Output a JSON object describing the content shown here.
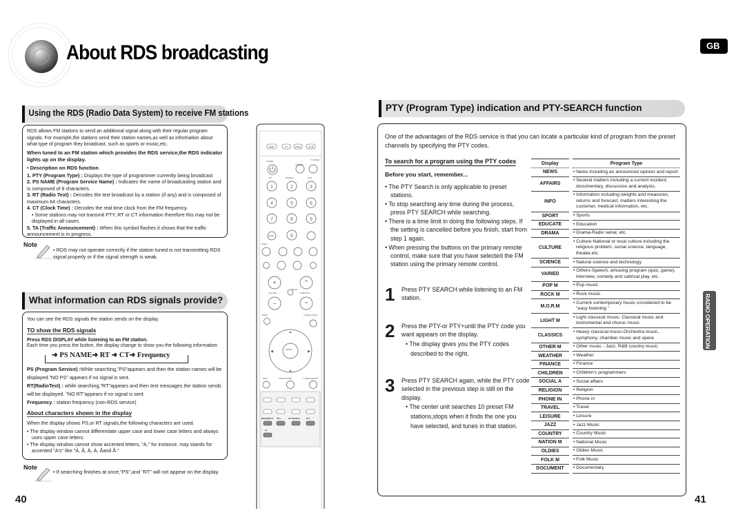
{
  "header": {
    "title": "About RDS broadcasting",
    "lang_badge": "GB",
    "speaker_icon": "speaker-icon"
  },
  "left": {
    "section1": {
      "heading": "Using the RDS (Radio Data System) to receive FM stations",
      "intro": "RDS allows FM stations to send an additional signal along with their regular program signals. For example,the stations send their station names,as well as information about what  type of program they broadcast, such as sports or music,etc.",
      "lead": "When tuned to an FM station which provides the RDS service,the RDS indicator lights up on the display.",
      "desc_title": "• Description on RDS function",
      "items": [
        {
          "label": "1. PTY (Program Type) :",
          "text": " Displays the type of programmer currently being broadcast"
        },
        {
          "label": "2. PS NAME (Program Service Name) :",
          "text": " Indicates the name of broadcasting station and is composed of 8 characters."
        },
        {
          "label": "3. RT (Radio Text) :",
          "text": " Decodes the text broadcast by a station (if any) and is composed of maximum 64 characters."
        },
        {
          "label": "4. CT (Clock Time) :",
          "text": " Decodes the real time clock from the FM frequency."
        },
        {
          "label": "",
          "text": "• Some stations may not transmit PTY, RT or CT information therefore this may not be displayed in all cases."
        },
        {
          "label": "5. TA (Traffic Announcement) :",
          "text": " When this symbol flashes it shows that the traffic announcement is in progress."
        }
      ],
      "note_label": "Note",
      "note": "• RDS may not operate correctly if the station tuned is not transmitting RDS signal properly or if the signal strength is weak."
    },
    "section2": {
      "heading": "What information can RDS signals provide?",
      "intro": "You can see the RDS signals the station sends on the display.",
      "subhead": "TO show the RDS signals",
      "press": "Press RDS DISPLAY while listening to an FM station.",
      "each_time": "Each time you press the button, the display change to show you the following information:",
      "flow": "➜ PS NAME➜ RT ➜ CT➜ Frequency",
      "defs": [
        {
          "label": "PS (Program Service) :",
          "text": "While searching,\"PS\"appears and then the station names will be displayed.\"NO PS\" appears if no signal is sent."
        },
        {
          "label": "RT(RadioText) :",
          "text": " while searching,\"RT\"appears and then text messages the station sends will be displayed. \"NO RT\"appears if no signal is sent."
        },
        {
          "label": "Frequency :",
          "text": " station frequency (non-RDS service)"
        }
      ],
      "chars_head": "About characters shown in the display",
      "chars_intro": "When the display shows PS,or RT signals,the following characters are used.",
      "chars_bullets": [
        "• The display window cannot differentiate upper case and lower case letters and always uses upper case letters.",
        "• The display window  cannot show accented letters, \"A,\" for instance, may stands for accented \"A's\" like \"À, Â, Ä, Á, Åand Ã.\""
      ],
      "note_label": "Note",
      "note": "• If searching finishes at once,\"PS\",and \"RT\" will not appear on the display."
    },
    "page_number": "40"
  },
  "remote": {
    "modes": [
      "AMP",
      "TV",
      "DVD",
      "VCR"
    ],
    "labels": {
      "power": "POWER",
      "tv_video": "TV/VIDEO",
      "dimmer": "DIMMER",
      "cd": "CD",
      "mp3": "MP3/EXT",
      "dvd": "DVD",
      "sleep": "SLEEP",
      "tuner": "TUNER",
      "mute": "MUTE",
      "volume": "VOLUME",
      "tuning": "TUNING/CH",
      "menu": "MENU",
      "tuning_mode": "TUNING MODE",
      "enter": "ENTER",
      "info": "INFO",
      "subwoofer": "SUB WOOFER",
      "tuner_memory": "TUNER MEMORY",
      "rds_display": "RDS DISPLAY",
      "pty_plus": "PTY +",
      "pty_search": "PTY SEARCH",
      "pty_minus": "PTY -",
      "ta": "TA"
    },
    "digits": [
      "1",
      "2",
      "3",
      "4",
      "5",
      "6",
      "7",
      "8",
      "9",
      "0"
    ]
  },
  "right": {
    "heading": "PTY (Program Type) indication and PTY-SEARCH function",
    "intro": "One  of the advantages of the RDS service is that you can locate a particular kind of program from the preset channels by specifying the PTY codes.",
    "search_head": "To search for a program using the PTY codes",
    "remember": "Before you start, remember...",
    "bullets": [
      "• The PTY Search is only applicable to preset stations.",
      "• To stop searching any time during the process, press PTY SEARCH while searching.",
      "• There is a time limit in doing the following steps. If the setting is cancelled before you finish, start from step 1 again.",
      "• When pressing the buttons on the primary remote control, make sure that you have selected the FM station using the primary remote control."
    ],
    "steps": [
      {
        "num": "1",
        "text": "Press PTY SEARCH while listening to an FM station.",
        "sub": ""
      },
      {
        "num": "2",
        "text": "Press the PTY-or PTY+until the PTY code you want appears on the display.",
        "sub": "• The display gives you the PTY codes described to the right."
      },
      {
        "num": "3",
        "text": "Press PTY SEARCH again, while the PTY code selected in the previous step is still on the display.",
        "sub": "• The center unit searches 10 preset FM stations,stops when it finds the one you have selected, and tunes in that station."
      }
    ],
    "table": {
      "headers": [
        "Display",
        "Program Type"
      ],
      "rows": [
        [
          "NEWS",
          "• News including an announced opinion and report"
        ],
        [
          "AFFAIRS",
          "• Several matters including a current incident, documentary, discussion and analysis."
        ],
        [
          "INFO",
          "• Information including weights and measures, returns and forecast, matters interesting the customer, medical information, etc."
        ],
        [
          "SPORT",
          "• Sports"
        ],
        [
          "EDUCATE",
          "• Education"
        ],
        [
          "DRAMA",
          "• Drama-Radio serial, etc."
        ],
        [
          "CULTURE",
          "• Culture-National or local culture including the religious problem, social science, language, theater,etc."
        ],
        [
          "SCIENCE",
          "• Natural science and technology"
        ],
        [
          "VARIED",
          "• Others-Speech, amusing program (quiz, game), interview, comedy and satirical play, etc."
        ],
        [
          "POP M",
          "• Pop music"
        ],
        [
          "ROCK M",
          "• Rock music"
        ],
        [
          "M.O.R.M",
          "• Current contemporary music considered to be \"easy listening.\""
        ],
        [
          "LIGHT M",
          "• Light classical music- Classical music and instrumental and chorus music"
        ],
        [
          "CLASSICS",
          "• Heavy classical  music-Orchestra music, symphony, chamber music and opera"
        ],
        [
          "OTHER M",
          "• Other music - Jazz, R&B country music"
        ],
        [
          "WEATHER",
          "• Weather"
        ],
        [
          "FINANCE",
          "• Finance"
        ],
        [
          "CHILDREN",
          "• Children's programmers"
        ],
        [
          "SOCIAL A",
          "• Social affairs"
        ],
        [
          "RELIGION",
          "• Religion"
        ],
        [
          "PHONE IN",
          "• Phone in"
        ],
        [
          "TRAVEL",
          "• Travel"
        ],
        [
          "LEISURE",
          "• Leisure"
        ],
        [
          "JAZZ",
          "• Jazz Music"
        ],
        [
          "COUNTRY",
          "• Country Music"
        ],
        [
          "NATION M",
          "• National Music"
        ],
        [
          "OLDIES",
          "• Oldies Music"
        ],
        [
          "FOLK M",
          "• Folk Music"
        ],
        [
          "DOCUMENT",
          "• Documentary"
        ]
      ]
    },
    "side_tab": "RADIO OPERATION",
    "page_number": "41"
  }
}
